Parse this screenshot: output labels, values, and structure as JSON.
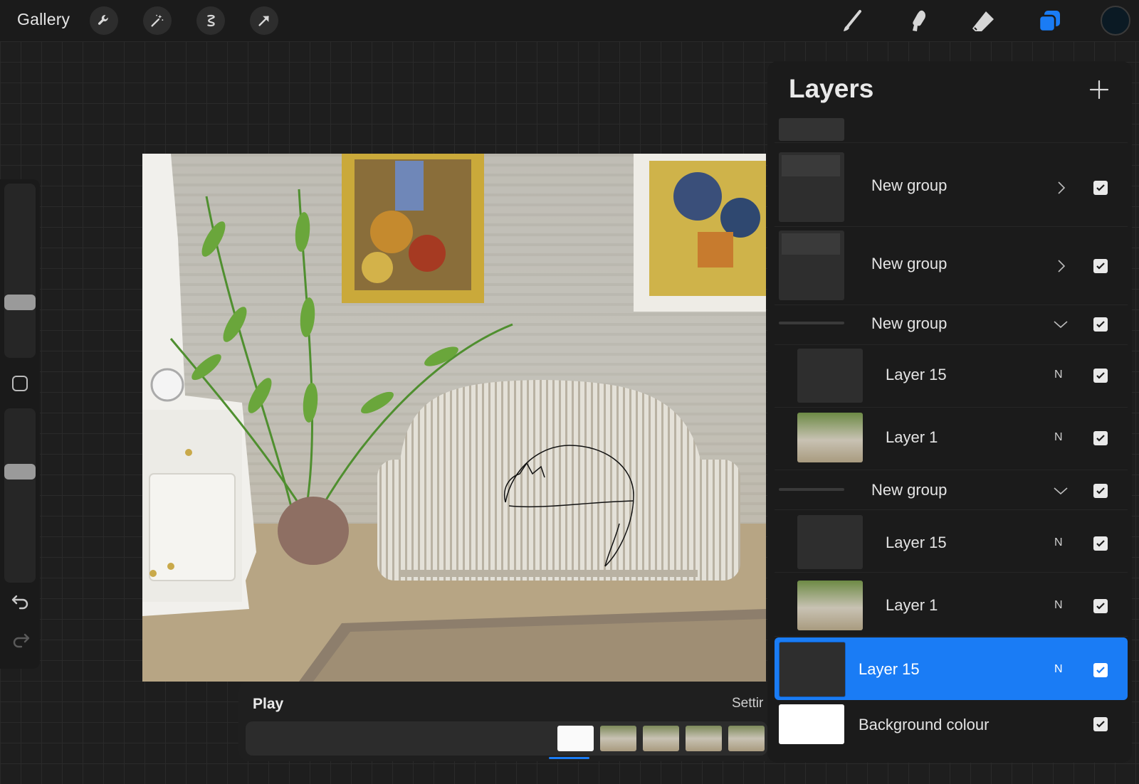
{
  "topbar": {
    "gallery_label": "Gallery",
    "left_tools": [
      "wrench-icon",
      "magic-wand-icon",
      "selection-icon",
      "transform-arrow-icon"
    ],
    "right_tools": [
      "brush-icon",
      "smudge-icon",
      "eraser-icon",
      "layers-icon"
    ],
    "active_tool": "layers-icon",
    "current_color": "#0b1a24"
  },
  "sidebar": {
    "brush_size_level": 0.3,
    "opacity_level": 0.65
  },
  "animation": {
    "play_label": "Play",
    "settings_label": "Settir",
    "selected_frame_index": 0
  },
  "layers": {
    "title": "Layers",
    "rows": [
      {
        "name": "",
        "kind": "partial"
      },
      {
        "name": "New group",
        "kind": "group",
        "expanded": false,
        "visible": true
      },
      {
        "name": "New group",
        "kind": "group",
        "expanded": false,
        "visible": true
      },
      {
        "name": "New group",
        "kind": "group",
        "expanded": true,
        "visible": true
      },
      {
        "name": "Layer 15",
        "kind": "layer",
        "mode": "N",
        "visible": true
      },
      {
        "name": "Layer 1",
        "kind": "layer",
        "mode": "N",
        "visible": true
      },
      {
        "name": "New group",
        "kind": "group",
        "expanded": true,
        "visible": true
      },
      {
        "name": "Layer 15",
        "kind": "layer",
        "mode": "N",
        "visible": true
      },
      {
        "name": "Layer 1",
        "kind": "layer",
        "mode": "N",
        "visible": true
      },
      {
        "name": "Layer 15",
        "kind": "layer",
        "mode": "N",
        "visible": true,
        "selected": true
      },
      {
        "name": "Background colour",
        "kind": "background",
        "visible": true
      }
    ]
  },
  "colors": {
    "accent": "#1a7cf5",
    "panel": "#1b1b1b"
  }
}
